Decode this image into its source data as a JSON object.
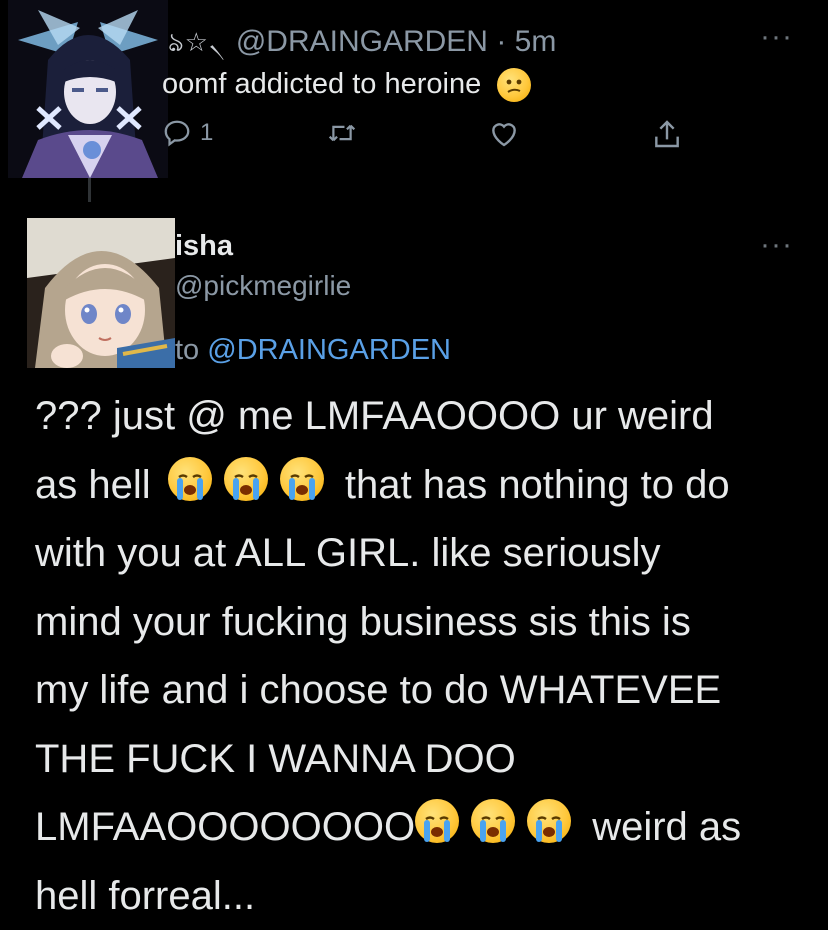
{
  "parent_tweet": {
    "display_name_decoration": "ঌ☆৲",
    "handle": "@DRAINGARDEN",
    "separator": "·",
    "time": "5m",
    "text": "oomf addicted to heroine",
    "emoji": "confused-face",
    "reply_count": "1",
    "more": "···"
  },
  "reply_tweet": {
    "display_name": "isha",
    "handle": "@pickmegirlie",
    "replying_prefix": "to",
    "replying_mention": "@DRAINGARDEN",
    "more": "···",
    "body_lines": [
      "??? just @ me LMFAAOOOO ur weird",
      "as hell",
      "that has nothing to do",
      "with you at ALL GIRL. like seriously",
      "mind your fucking business sis this is",
      "my life and i choose to do WHATEVEE",
      "THE FUCK I WANNA DOO",
      "LMFAAOOOOOOOO",
      "weird as",
      "hell forreal..."
    ],
    "emoji": "loudly-crying-face"
  },
  "colors": {
    "background": "#000000",
    "text": "#e7e9ea",
    "muted": "#8b98a5",
    "link": "#5aa0e6"
  }
}
